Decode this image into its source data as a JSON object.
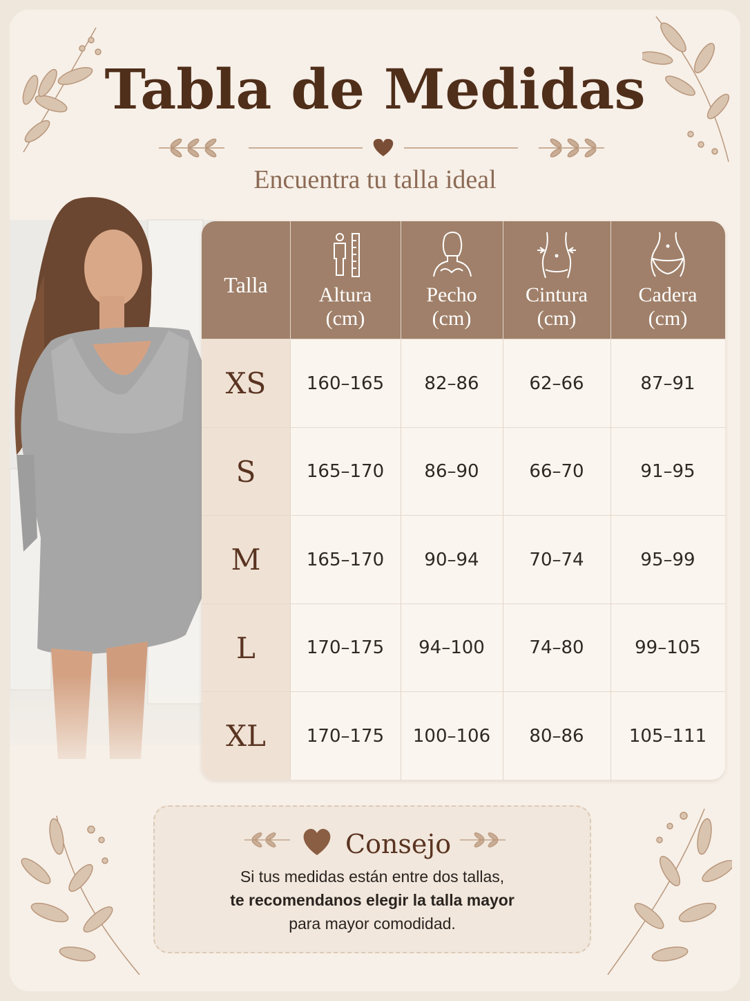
{
  "header": {
    "title": "Tabla de Medidas",
    "subtitle": "Encuentra tu talla ideal"
  },
  "colors": {
    "background": "#f7f0e8",
    "title": "#4f2e1a",
    "header_bg": "#a0806a",
    "size_col_bg": "#efe2d5",
    "leaf": "#c9ad95"
  },
  "table": {
    "columns": [
      {
        "label": "Talla",
        "unit": "",
        "icon": ""
      },
      {
        "label": "Altura",
        "unit": "(cm)",
        "icon": "height-ruler-icon"
      },
      {
        "label": "Pecho",
        "unit": "(cm)",
        "icon": "bust-icon"
      },
      {
        "label": "Cintura",
        "unit": "(cm)",
        "icon": "waist-icon"
      },
      {
        "label": "Cadera",
        "unit": "(cm)",
        "icon": "hip-icon"
      }
    ],
    "rows": [
      {
        "size": "XS",
        "altura": "160–165",
        "pecho": "82–86",
        "cintura": "62–66",
        "cadera": "87–91"
      },
      {
        "size": "S",
        "altura": "165–170",
        "pecho": "86–90",
        "cintura": "66–70",
        "cadera": "91–95"
      },
      {
        "size": "M",
        "altura": "165–170",
        "pecho": "90–94",
        "cintura": "70–74",
        "cadera": "95–99"
      },
      {
        "size": "L",
        "altura": "170–175",
        "pecho": "94–100",
        "cintura": "74–80",
        "cadera": "99–105"
      },
      {
        "size": "XL",
        "altura": "170–175",
        "pecho": "100–106",
        "cintura": "80–86",
        "cadera": "105–111"
      }
    ]
  },
  "tip": {
    "title": "Consejo",
    "line1": "Si tus medidas están entre dos tallas,",
    "line2": "te recomendanos elegir la talla mayor",
    "line3": "para mayor comodidad."
  }
}
